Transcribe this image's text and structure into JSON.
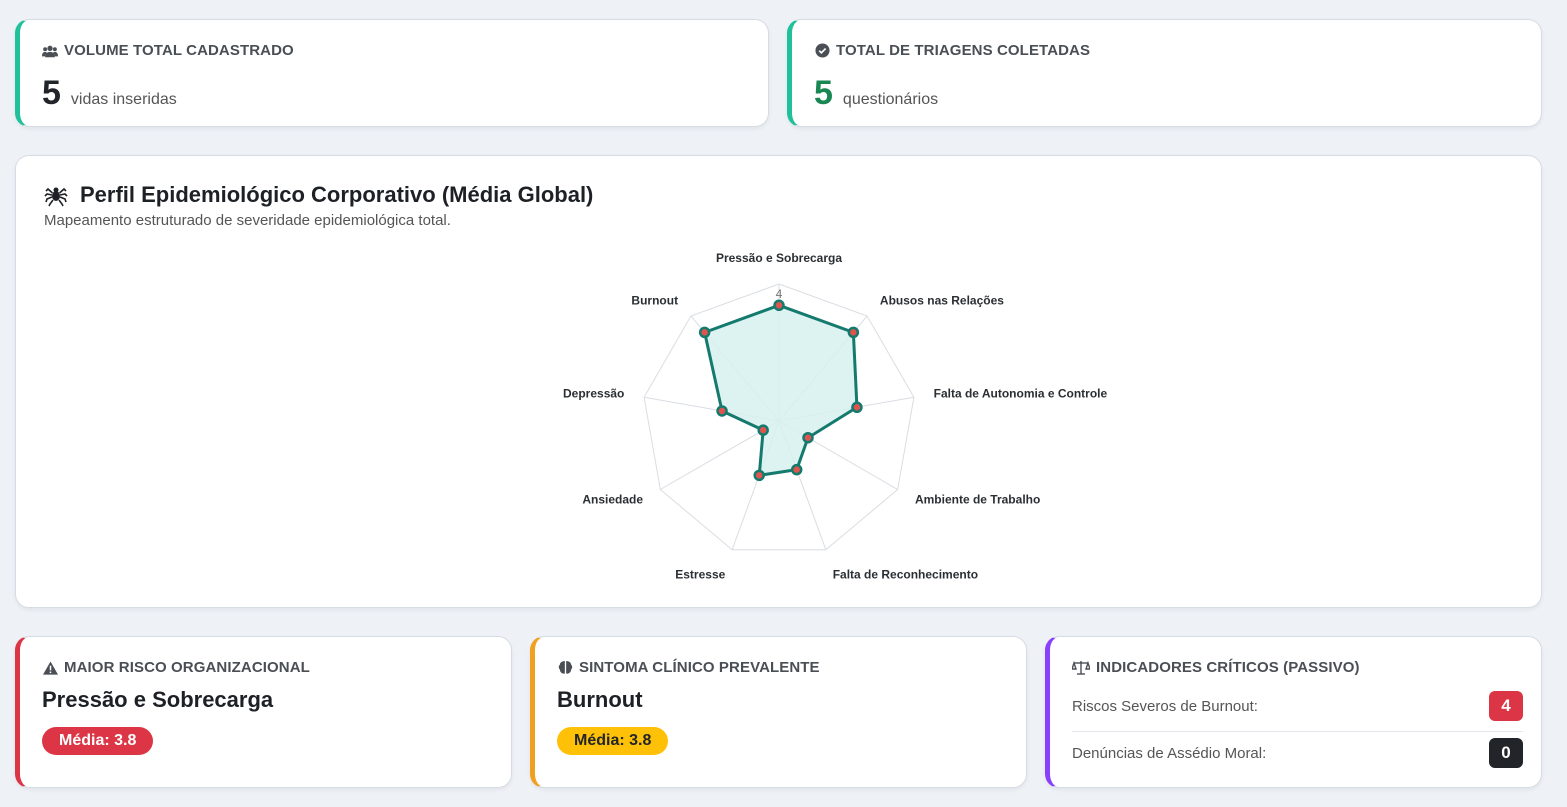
{
  "kpi_volume": {
    "title": "VOLUME TOTAL CADASTRADO",
    "value": "5",
    "unit": "vidas inseridas",
    "icon": "users-icon"
  },
  "kpi_triagens": {
    "title": "TOTAL DE TRIAGENS COLETADAS",
    "value": "5",
    "unit": "questionários",
    "icon": "check-circle-icon"
  },
  "profile": {
    "title": "Perfil Epidemiológico Corporativo (Média Global)",
    "subtitle": "Mapeamento estruturado de severidade epidemiológica total.",
    "icon": "spider-icon"
  },
  "chart_data": {
    "type": "radar",
    "categories": [
      "Pressão e Sobrecarga",
      "Abusos nas Relações",
      "Falta de Autonomia e Controle",
      "Ambiente de Trabalho",
      "Falta de Reconhecimento",
      "Estresse",
      "Ansiedade",
      "Depressão",
      "Burnout"
    ],
    "series": [
      {
        "values": [
          3.8,
          3.8,
          2.6,
          1.1,
          1.7,
          1.9,
          0.6,
          1.9,
          3.8
        ]
      }
    ],
    "rlim": [
      0,
      4.5
    ],
    "tick_labels": [
      "4"
    ],
    "colors": {
      "line": "#157a6e",
      "fill": "#d6f1ee",
      "point": "#e0544f",
      "grid": "#d9dde2"
    }
  },
  "risk": {
    "title": "MAIOR RISCO ORGANIZACIONAL",
    "name": "Pressão e Sobrecarga",
    "badge": "Média: 3.8",
    "icon": "warning-icon",
    "color": "#dc3545"
  },
  "symptom": {
    "title": "SINTOMA CLÍNICO PREVALENTE",
    "name": "Burnout",
    "badge": "Média: 3.8",
    "icon": "brain-icon",
    "color": "#ffc107"
  },
  "indicators": {
    "title": "INDICADORES CRÍTICOS (PASSIVO)",
    "icon": "scale-icon",
    "items": [
      {
        "label": "Riscos Severos de Burnout:",
        "value": "4",
        "color": "#dc3545"
      },
      {
        "label": "Denúncias de Assédio Moral:",
        "value": "0",
        "color": "#212529"
      }
    ]
  },
  "accents": {
    "teal": "#20c09a",
    "red": "#dc3545",
    "orange": "#f0a020",
    "purple": "#8a3ffc",
    "green_value": "#198754"
  }
}
